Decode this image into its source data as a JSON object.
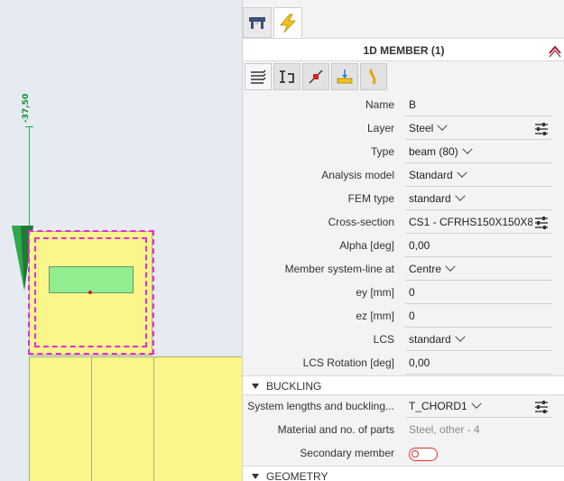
{
  "viewport": {
    "dimension_label": "-37,50",
    "colors": {
      "background": "#e6ebf2",
      "member": "#fbf68a",
      "section": "#90ee90",
      "selection": "#e82ad8",
      "dimension": "#22b14c"
    }
  },
  "panel": {
    "top_tabs": [
      {
        "icon": "structure-icon",
        "active": false
      },
      {
        "icon": "lightning-icon",
        "active": true
      }
    ],
    "title": "1D MEMBER (1)",
    "toolbar_icons": [
      "layers-icon",
      "section-icon",
      "pin-icon",
      "load-icon",
      "curve-icon"
    ],
    "properties": [
      {
        "label": "Name",
        "value": "B"
      },
      {
        "label": "Layer",
        "value": "Steel",
        "dropdown": true,
        "settings": true
      },
      {
        "label": "Type",
        "value": "beam (80)",
        "dropdown": true
      },
      {
        "label": "Analysis model",
        "value": "Standard",
        "dropdown": true
      },
      {
        "label": "FEM type",
        "value": "standard",
        "dropdown": true
      },
      {
        "label": "Cross-section",
        "value": "CS1 - CFRHS150X150X8",
        "settings": true
      },
      {
        "label": "Alpha [deg]",
        "value": "0,00"
      },
      {
        "label": "Member system-line at",
        "value": "Centre",
        "dropdown": true
      },
      {
        "label": "ey [mm]",
        "value": "0"
      },
      {
        "label": "ez [mm]",
        "value": "0"
      },
      {
        "label": "LCS",
        "value": "standard",
        "dropdown": true
      },
      {
        "label": "LCS Rotation [deg]",
        "value": "0,00"
      }
    ],
    "buckling": {
      "title": "BUCKLING",
      "rows": [
        {
          "label": "System lengths and buckling...",
          "value": "T_CHORD1",
          "dropdown": true,
          "settings": true
        },
        {
          "label": "Material and no. of parts",
          "value": "Steel, other - 4",
          "dim": true
        },
        {
          "label": "Secondary member",
          "toggle": false
        }
      ]
    },
    "geometry": {
      "title": "GEOMETRY"
    }
  }
}
